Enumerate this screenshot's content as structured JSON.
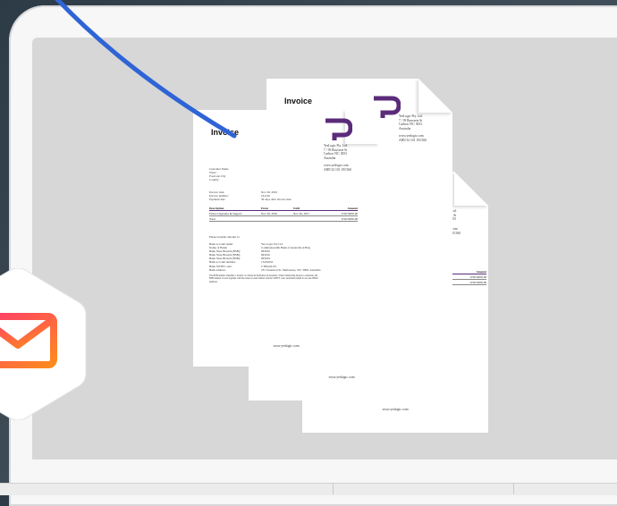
{
  "invoice": {
    "title": "Invoice",
    "company_address": "YesLogic Pty. Ltd.\n7 / 39 Bouverie St\nCarlton VIC 3053\nAustralia",
    "company_contact": "www.yeslogic.com\nABN 32 101 193 560",
    "customer": "Customer Name\nStreet\nPostcode City\nCountry",
    "meta_labels": "Invoice date:\nInvoice number:\nPayment due:",
    "meta_values": "Nov 26, 2016\n161126\n30 days after invoice date",
    "table_headers": [
      "Description",
      "From",
      "Until",
      "Amount"
    ],
    "table_row": [
      "Prince Upgrades & Support",
      "Nov 26, 2016",
      "Nov 26, 2017",
      "USD $950.00"
    ],
    "total_label": "Total",
    "total_value": "USD $950.00",
    "transfer_heading": "Please transfer amount to:",
    "bank_labels": "Bank account name:\nName of Bank:\nBank State Branch (BSB):\nBank State Branch (BSB):\nBank State Branch (BSB):\nBank account number:\nBank SWIFT code:\nBank address:",
    "bank_values": "Yes Logic Pty Ltd\nCommonwealth Bank of Australia (CBA)\n063010\n063010\n063019\n13201652\nCTBAAU2S\n231 Swanston St, Melbourne, VIC 3000, Australia",
    "note": "The BSB number identifies a branch of a financial institution in Australia. When transferring money to Australia, the\nBSB number is used together with the bank account number and the SWIFT code. Australian banks do not use IBAN\nnumbers.",
    "footer": "www.yeslogic.com",
    "back_amount_label": "Amount",
    "back_amount_value": "USD $950.00",
    "back_australia": "Australia"
  },
  "colors": {
    "logo_purple": "#5b2b7a",
    "swoosh_blue": "#2f64d6",
    "mail_gradient_start": "#ff3b6b",
    "mail_gradient_end": "#ff8a1e"
  },
  "icons": {
    "mail": "mail-icon"
  }
}
